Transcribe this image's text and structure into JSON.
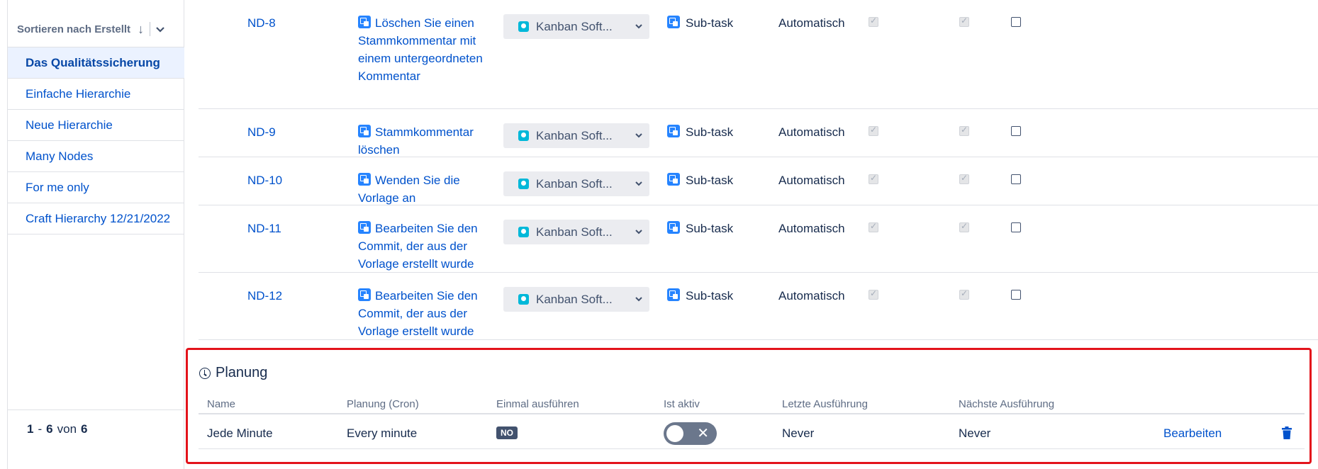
{
  "sidebar": {
    "sort_label": "Sortieren nach Erstellt",
    "sort_arrow": "↓",
    "sort_chevron": "⌄",
    "items": [
      {
        "label": "Das Qualitätssicherung"
      },
      {
        "label": "Einfache Hierarchie"
      },
      {
        "label": "Neue Hierarchie"
      },
      {
        "label": "Many Nodes"
      },
      {
        "label": "For me only"
      },
      {
        "label": "Craft Hierarchy 12/21/2022"
      }
    ],
    "pager": {
      "from": "1",
      "dash": "-",
      "to": "6",
      "of_label": "von",
      "total": "6"
    }
  },
  "rows": [
    {
      "key": "ND-8",
      "summary": "Löschen Sie einen Stammkommentar mit einem untergeordneten Kommentar",
      "project": "Kanban Soft...",
      "type": "Sub-task",
      "mode": "Automatisch"
    },
    {
      "key": "ND-9",
      "summary": "Stammkommentar löschen",
      "project": "Kanban Soft...",
      "type": "Sub-task",
      "mode": "Automatisch"
    },
    {
      "key": "ND-10",
      "summary": "Wenden Sie die Vorlage an",
      "project": "Kanban Soft...",
      "type": "Sub-task",
      "mode": "Automatisch"
    },
    {
      "key": "ND-11",
      "summary": "Bearbeiten Sie den Commit, der aus der Vorlage erstellt wurde",
      "project": "Kanban Soft...",
      "type": "Sub-task",
      "mode": "Automatisch"
    },
    {
      "key": "ND-12",
      "summary": "Bearbeiten Sie den Commit, der aus der Vorlage erstellt wurde",
      "project": "Kanban Soft...",
      "type": "Sub-task",
      "mode": "Automatisch"
    }
  ],
  "planung": {
    "title": "Planung",
    "headers": {
      "name": "Name",
      "cron": "Planung (Cron)",
      "once": "Einmal ausführen",
      "active": "Ist aktiv",
      "last": "Letzte Ausführung",
      "next": "Nächste Ausführung"
    },
    "row": {
      "name": "Jede Minute",
      "cron": "Every minute",
      "once_badge": "NO",
      "active_x": "✕",
      "last": "Never",
      "next": "Never",
      "edit_label": "Bearbeiten"
    }
  },
  "colors": {
    "accent": "#0052cc",
    "highlight_border": "#e3131b",
    "toggle_off": "#6b778c"
  }
}
